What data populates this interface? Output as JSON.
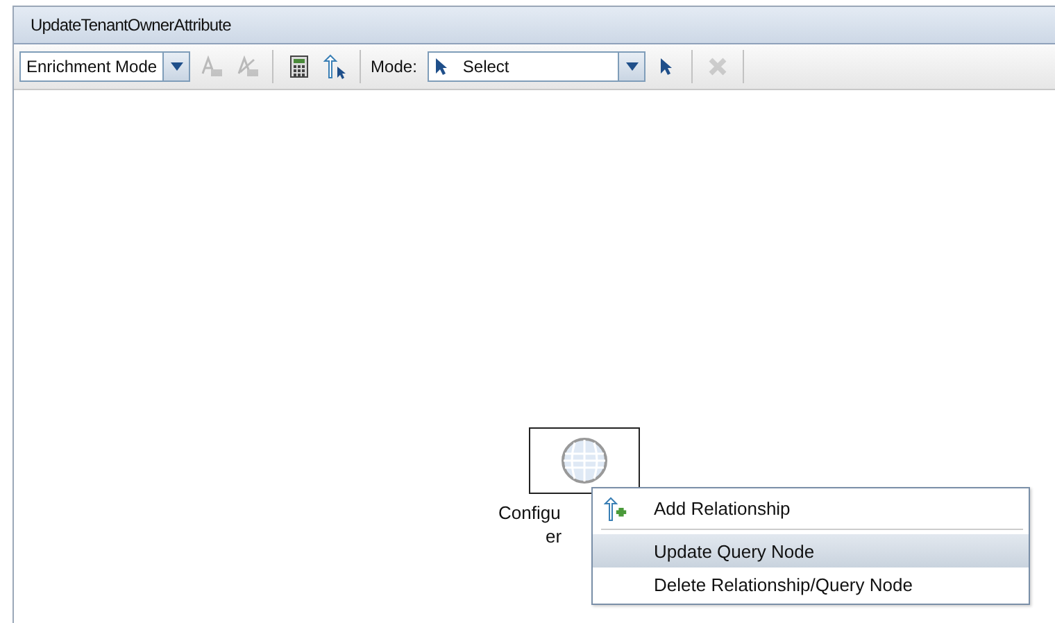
{
  "window": {
    "title": "UpdateTenantOwnerAttribute"
  },
  "toolbar": {
    "enrichment_dropdown": {
      "value": "Enrichment Mode"
    },
    "tools": [
      {
        "kind": "attr",
        "disabled": true
      },
      {
        "kind": "attr2",
        "disabled": true
      },
      {
        "kind": "sep"
      },
      {
        "kind": "calc",
        "disabled": false
      },
      {
        "kind": "relation",
        "disabled": false
      },
      {
        "kind": "sep"
      }
    ],
    "mode_label": "Mode:",
    "mode_dropdown": {
      "value": "Select"
    },
    "tools_after": [
      {
        "kind": "pointer",
        "disabled": false
      },
      {
        "kind": "sep"
      },
      {
        "kind": "delete",
        "disabled": true
      },
      {
        "kind": "sep"
      }
    ]
  },
  "canvas": {
    "node": {
      "label_lines": [
        "Configu",
        "er"
      ],
      "selected": true
    }
  },
  "context_menu": {
    "items": [
      {
        "label": "Add Relationship",
        "icon": true,
        "selected": false
      },
      {
        "kind": "sep"
      },
      {
        "label": "Update Query Node",
        "icon": false,
        "selected": true
      },
      {
        "label": "Delete Relationship/Query Node",
        "icon": false,
        "selected": false
      }
    ]
  }
}
